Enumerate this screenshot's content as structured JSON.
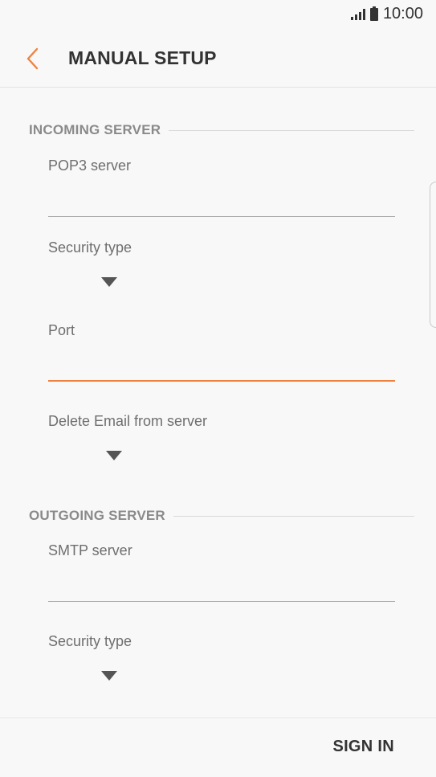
{
  "status_bar": {
    "time": "10:00"
  },
  "app_bar": {
    "title": "MANUAL SETUP"
  },
  "incoming": {
    "header": "INCOMING SERVER",
    "server_label": "POP3 server",
    "security_label": "Security type",
    "port_label": "Port",
    "delete_label": "Delete Email from server"
  },
  "outgoing": {
    "header": "OUTGOING SERVER",
    "server_label": "SMTP server",
    "security_label": "Security type"
  },
  "actions": {
    "sign_in": "SIGN IN"
  },
  "colors": {
    "accent": "#f08240",
    "text": "#333333",
    "muted": "#8a8a8a"
  }
}
